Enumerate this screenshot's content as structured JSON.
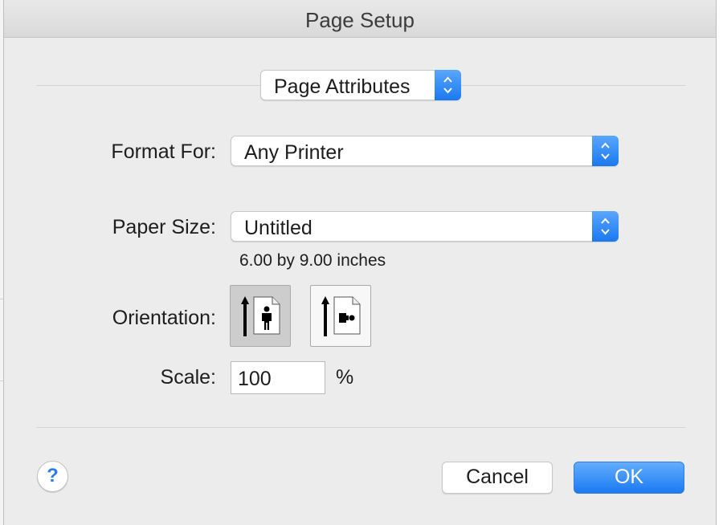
{
  "window": {
    "title": "Page Setup"
  },
  "settings_popup": {
    "value": "Page Attributes"
  },
  "format_for": {
    "label": "Format For:",
    "value": "Any Printer"
  },
  "paper_size": {
    "label": "Paper Size:",
    "value": "Untitled",
    "dimensions": "6.00 by 9.00 inches"
  },
  "orientation": {
    "label": "Orientation:",
    "selected": "portrait",
    "options": [
      "portrait-icon",
      "landscape-icon"
    ]
  },
  "scale": {
    "label": "Scale:",
    "value": "100",
    "unit": "%"
  },
  "buttons": {
    "help": "?",
    "cancel": "Cancel",
    "ok": "OK"
  },
  "colors": {
    "accent": "#1a79f0",
    "background": "#ececec"
  }
}
